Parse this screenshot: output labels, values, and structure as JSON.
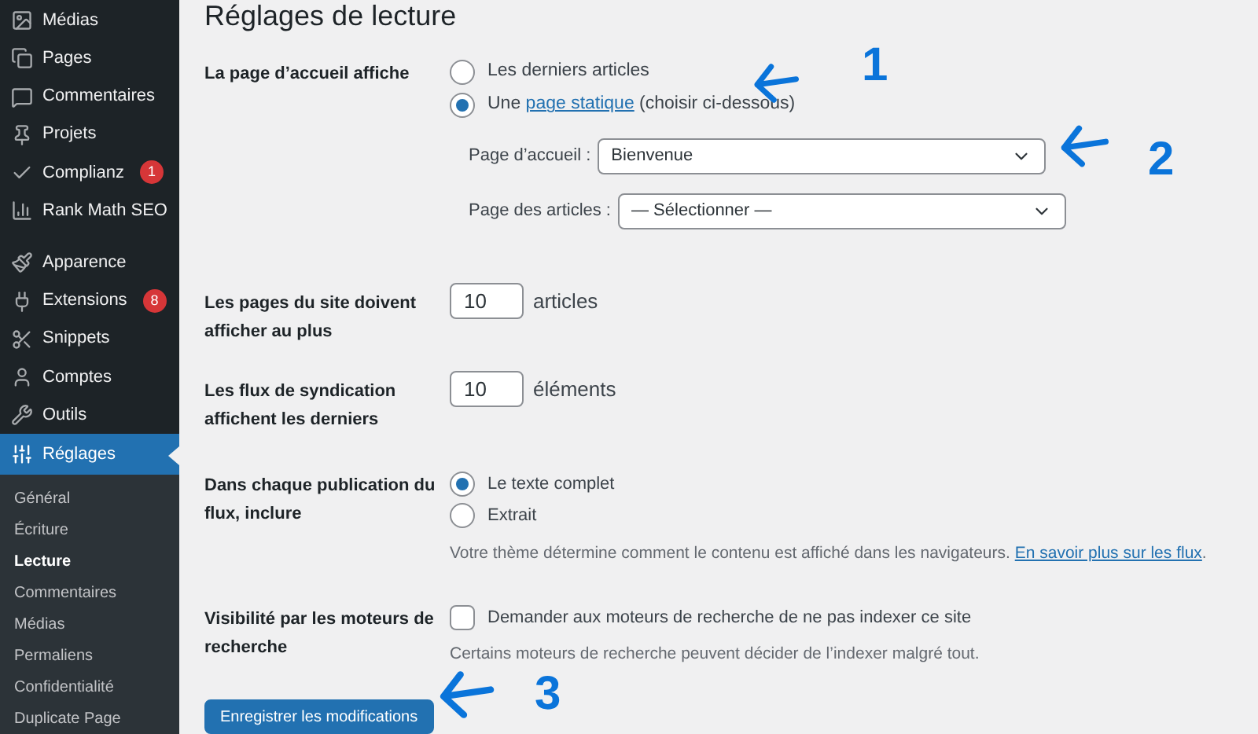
{
  "sidebar": {
    "items": [
      {
        "label": "Médias",
        "selected": false
      },
      {
        "label": "Pages",
        "selected": false
      },
      {
        "label": "Commentaires",
        "selected": false
      },
      {
        "label": "Projets",
        "selected": false
      },
      {
        "label": "Complianz",
        "selected": false,
        "badge": "1"
      },
      {
        "label": "Rank Math SEO",
        "selected": false
      },
      {
        "label": "Apparence",
        "selected": false
      },
      {
        "label": "Extensions",
        "selected": false,
        "badge": "8"
      },
      {
        "label": "Snippets",
        "selected": false
      },
      {
        "label": "Comptes",
        "selected": false
      },
      {
        "label": "Outils",
        "selected": false
      },
      {
        "label": "Réglages",
        "selected": true
      }
    ],
    "submenu": [
      {
        "label": "Général",
        "selected": false
      },
      {
        "label": "Écriture",
        "selected": false
      },
      {
        "label": "Lecture",
        "selected": true
      },
      {
        "label": "Commentaires",
        "selected": false
      },
      {
        "label": "Médias",
        "selected": false
      },
      {
        "label": "Permaliens",
        "selected": false
      },
      {
        "label": "Confidentialité",
        "selected": false
      },
      {
        "label": "Duplicate Page",
        "selected": false
      }
    ]
  },
  "page_title": "Réglages de lecture",
  "homepage": {
    "label": "La page d’accueil affiche",
    "options": [
      {
        "before": "Les derniers articles",
        "selected": false
      },
      {
        "before": "Une ",
        "link": "page statique",
        "after": " (choisir ci-dessous)",
        "selected": true
      }
    ],
    "selects": [
      {
        "label": "Page d’accueil :",
        "value": "Bienvenue"
      },
      {
        "label": "Page des articles :",
        "value": "— Sélectionner —"
      }
    ]
  },
  "posts_per_page": {
    "label": "Les pages du site doivent afficher au plus",
    "value": "10",
    "unit": "articles"
  },
  "feed_items": {
    "label": "Les flux de syndication affichent les derniers",
    "value": "10",
    "unit": "éléments"
  },
  "feed_content": {
    "label": "Dans chaque publication du flux, inclure",
    "options": [
      {
        "label": "Le texte complet",
        "selected": true
      },
      {
        "label": "Extrait",
        "selected": false
      }
    ],
    "description": "Votre thème détermine comment le contenu est affiché dans les navigateurs.",
    "link": "En savoir plus sur les flux",
    "after": "."
  },
  "visibility": {
    "label": "Visibilité par les moteurs de recherche",
    "checkbox": {
      "label": "Demander aux moteurs de recherche de ne pas indexer ce site",
      "checked": false
    },
    "description": "Certains moteurs de recherche peuvent décider de l’indexer malgré tout."
  },
  "save_button": "Enregistrer les modifications",
  "annotations": [
    "1",
    "2",
    "3"
  ]
}
